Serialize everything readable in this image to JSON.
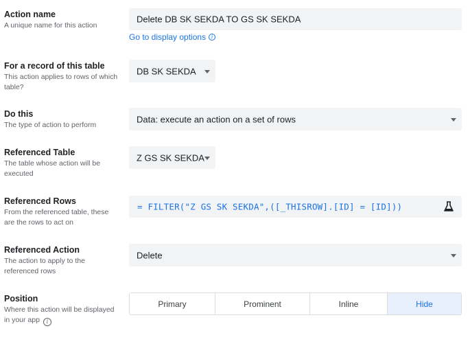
{
  "action_name": {
    "title": "Action name",
    "desc": "A unique name for this action",
    "value": "Delete DB SK SEKDA TO GS SK SEKDA",
    "link": "Go to display options"
  },
  "for_record": {
    "title": "For a record of this table",
    "desc": "This action applies to rows of which table?",
    "value": "DB SK SEKDA"
  },
  "do_this": {
    "title": "Do this",
    "desc": "The type of action to perform",
    "value": "Data: execute an action on a set of rows"
  },
  "referenced_table": {
    "title": "Referenced Table",
    "desc": "The table whose action will be executed",
    "value": "Z GS SK SEKDA"
  },
  "referenced_rows": {
    "title": "Referenced Rows",
    "desc": "From the referenced table, these are the rows to act on",
    "formula": "= FILTER(\"Z GS SK SEKDA\",([_THISROW].[ID] = [ID]))"
  },
  "referenced_action": {
    "title": "Referenced Action",
    "desc": "The action to apply to the referenced rows",
    "value": "Delete"
  },
  "position": {
    "title": "Position",
    "desc": "Where this action will be displayed in your app",
    "options": [
      "Primary",
      "Prominent",
      "Inline",
      "Hide"
    ],
    "selected": "Hide"
  },
  "colors": {
    "accent": "#1a73e8",
    "field_bg": "#f1f3f4",
    "selected_bg": "#e8f0fe"
  }
}
